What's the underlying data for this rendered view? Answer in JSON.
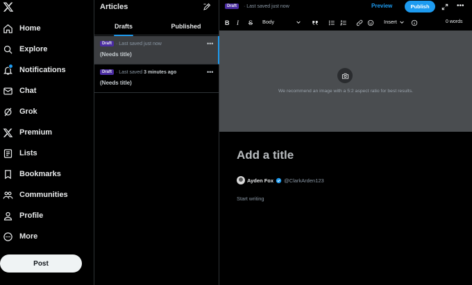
{
  "nav": {
    "items": [
      {
        "label": "Home",
        "icon": "home-icon"
      },
      {
        "label": "Explore",
        "icon": "search-icon"
      },
      {
        "label": "Notifications",
        "icon": "bell-icon"
      },
      {
        "label": "Chat",
        "icon": "mail-icon"
      },
      {
        "label": "Grok",
        "icon": "grok-icon"
      },
      {
        "label": "Premium",
        "icon": "x-logo-icon"
      },
      {
        "label": "Lists",
        "icon": "list-icon"
      },
      {
        "label": "Bookmarks",
        "icon": "bookmark-icon"
      },
      {
        "label": "Communities",
        "icon": "communities-icon"
      },
      {
        "label": "Profile",
        "icon": "person-icon"
      },
      {
        "label": "More",
        "icon": "more-circle-icon"
      }
    ],
    "post_label": "Post",
    "notification_dot_color": "#1d9bf0"
  },
  "articles": {
    "title": "Articles",
    "tabs": [
      {
        "label": "Drafts",
        "active": true
      },
      {
        "label": "Published",
        "active": false
      }
    ],
    "drafts": [
      {
        "badge": "Draft",
        "saved_prefix": "· Last saved",
        "saved_time": "just now",
        "title": "(Needs title)",
        "active": true
      },
      {
        "badge": "Draft",
        "saved_prefix": "· Last saved",
        "saved_time": "3 minutes ago",
        "title": "(Needs title)",
        "active": false
      }
    ]
  },
  "editor": {
    "status_badge": "Draft",
    "status_text": "· Last saved just now",
    "preview_label": "Preview",
    "publish_label": "Publish",
    "toolbar": {
      "style_value": "Body",
      "insert_label": "Insert",
      "word_count": "0 words"
    },
    "cover_hint": "We recommend an image with a 5:2 aspect ratio for best results.",
    "title_placeholder": "Add a title",
    "author": {
      "name": "Ayden Fox",
      "handle": "@ClarkArden123"
    },
    "body_placeholder": "Start writing"
  },
  "colors": {
    "accent": "#1d9bf0",
    "draft_badge": "#4b2ca3",
    "cover_bg": "#4a4d50"
  }
}
